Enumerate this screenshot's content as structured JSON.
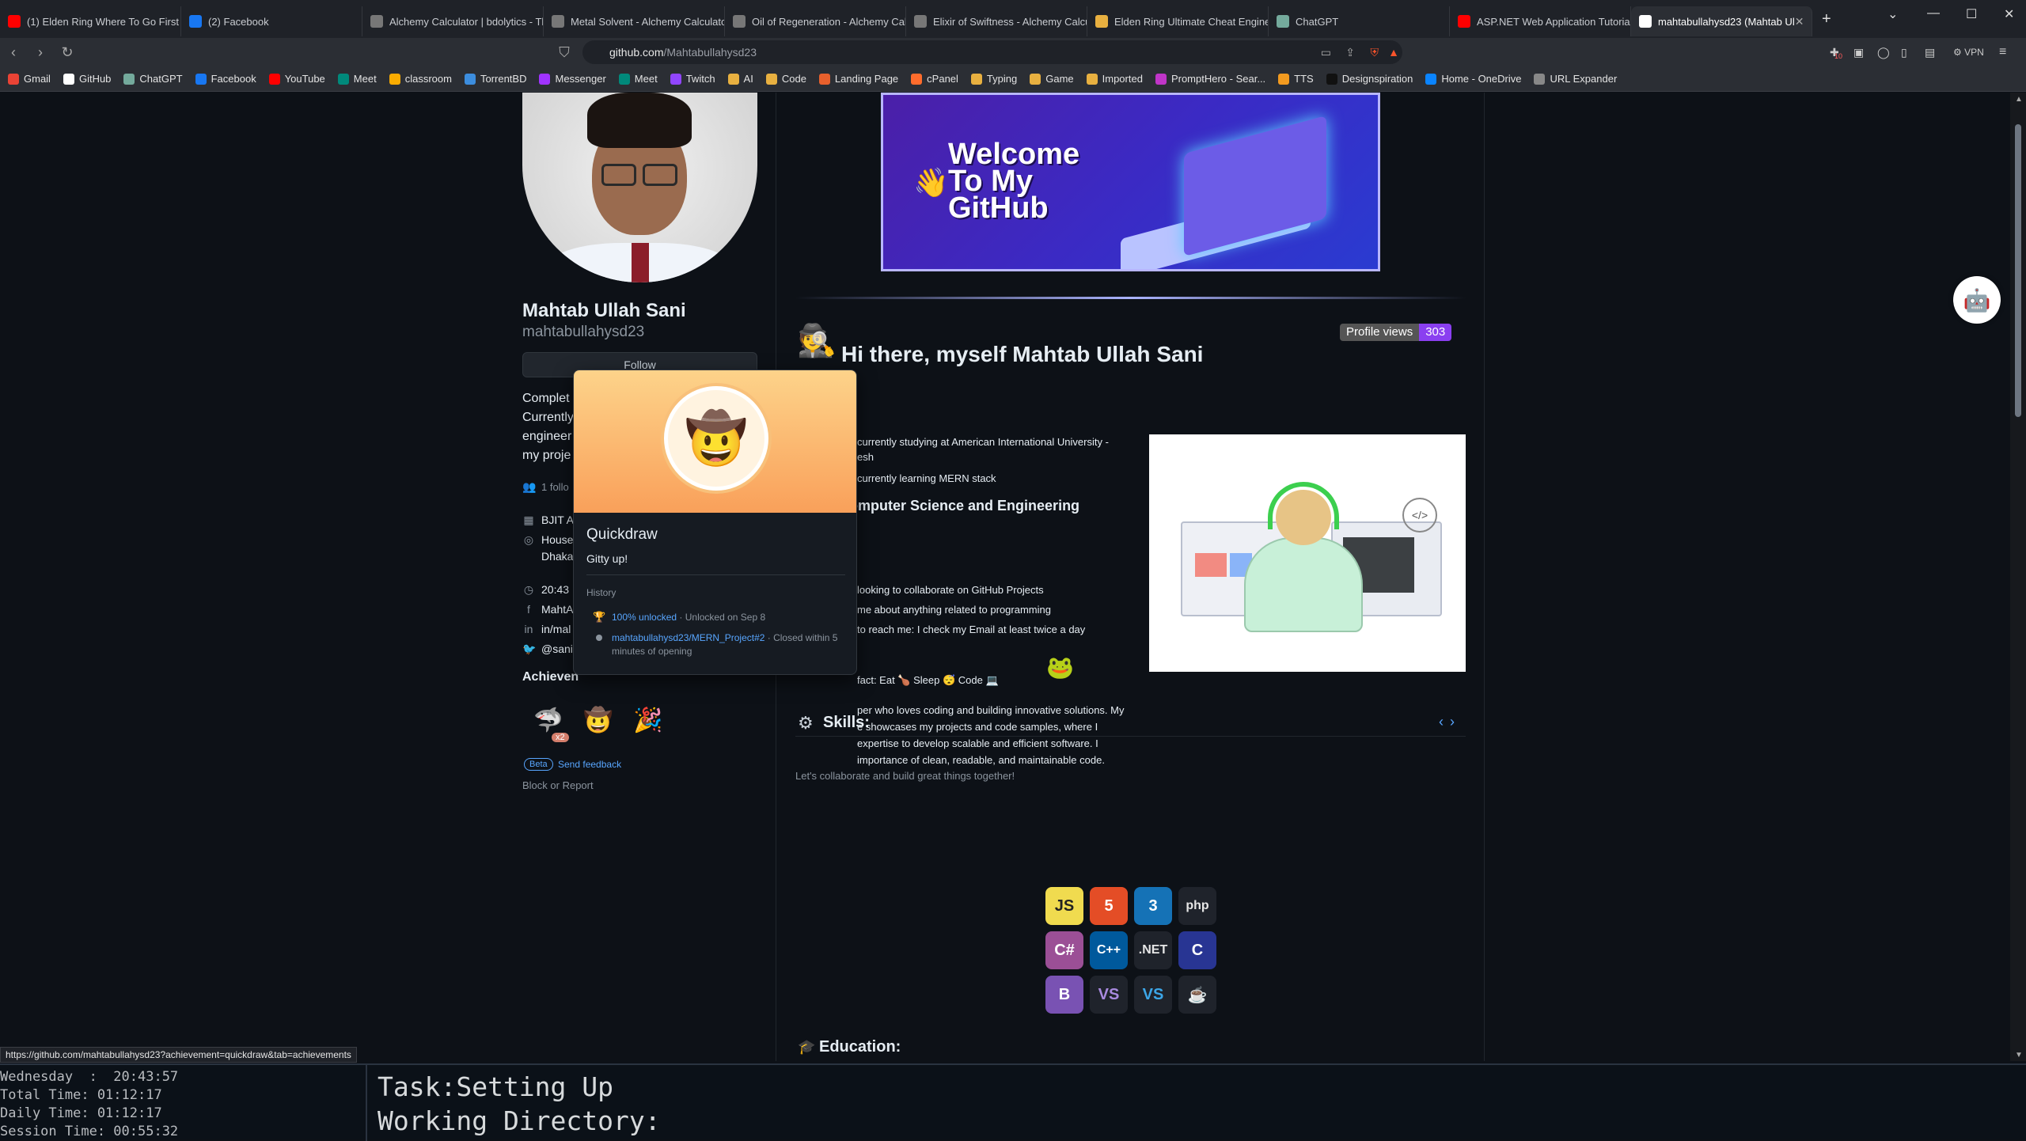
{
  "browser": {
    "tabs": [
      {
        "title": "(1) Elden Ring Where To Go First |",
        "color": "#ff0000",
        "icon": "youtube-icon"
      },
      {
        "title": "(2) Facebook",
        "color": "#1877f2",
        "icon": "facebook-icon"
      },
      {
        "title": "Alchemy Calculator | bdolytics - Th",
        "color": "#777777",
        "icon": "bdolytics-icon"
      },
      {
        "title": "Metal Solvent - Alchemy Calculato",
        "color": "#777777",
        "icon": "bdolytics-icon"
      },
      {
        "title": "Oil of Regeneration - Alchemy Cal",
        "color": "#777777",
        "icon": "bdolytics-icon"
      },
      {
        "title": "Elixir of Swiftness - Alchemy Calcul",
        "color": "#777777",
        "icon": "bdolytics-icon"
      },
      {
        "title": "Elden Ring Ultimate Cheat Engine",
        "color": "#e8b040",
        "icon": "cheat-engine-icon"
      },
      {
        "title": "ChatGPT",
        "color": "#74aa9c",
        "icon": "chatgpt-icon"
      },
      {
        "title": "ASP.NET Web Application Tutorial",
        "color": "#ff0000",
        "icon": "youtube-icon"
      },
      {
        "title": "mahtabullahysd23 (Mahtab Ul",
        "color": "#ffffff",
        "icon": "github-icon",
        "active": true
      }
    ],
    "new_tab": "+",
    "url": {
      "host": "github.com",
      "path": "/Mahtabullahysd23"
    },
    "vpn_label": "VPN",
    "notification_count": "10",
    "bookmarks": [
      {
        "label": "Gmail",
        "color": "#ea4335"
      },
      {
        "label": "GitHub",
        "color": "#ffffff"
      },
      {
        "label": "ChatGPT",
        "color": "#74aa9c"
      },
      {
        "label": "Facebook",
        "color": "#1877f2"
      },
      {
        "label": "YouTube",
        "color": "#ff0000"
      },
      {
        "label": "Meet",
        "color": "#00897b"
      },
      {
        "label": "classroom",
        "color": "#f9ab00"
      },
      {
        "label": "TorrentBD",
        "color": "#3c8dde"
      },
      {
        "label": "Messenger",
        "color": "#a033ff"
      },
      {
        "label": "Meet",
        "color": "#00897b"
      },
      {
        "label": "Twitch",
        "color": "#9146ff"
      },
      {
        "label": "AI",
        "color": "#e8b040"
      },
      {
        "label": "Code",
        "color": "#e8b040"
      },
      {
        "label": "Landing Page",
        "color": "#e8602c"
      },
      {
        "label": "cPanel",
        "color": "#ff6c2c"
      },
      {
        "label": "Typing",
        "color": "#e8b040"
      },
      {
        "label": "Game",
        "color": "#e8b040"
      },
      {
        "label": "Imported",
        "color": "#e8b040"
      },
      {
        "label": "PromptHero - Sear...",
        "color": "#c035c8"
      },
      {
        "label": "TTS",
        "color": "#f29a1f"
      },
      {
        "label": "Designspiration",
        "color": "#111111"
      },
      {
        "label": "Home - OneDrive",
        "color": "#0a84ff"
      },
      {
        "label": "URL Expander",
        "color": "#888888"
      }
    ],
    "status_url": "https://github.com/mahtabullahysd23?achievement=quickdraw&tab=achievements"
  },
  "profile": {
    "name": "Mahtab Ullah Sani",
    "login": "mahtabullahysd23",
    "follow_label": "Follow",
    "bio_lines": [
      "Complet",
      "Currently",
      "engineer",
      "my proje"
    ],
    "followers": "1 follo",
    "meta": [
      {
        "icon": "organization-icon",
        "text": "BJIT A"
      },
      {
        "icon": "location-icon",
        "text": "House"
      },
      {
        "icon": "location-cont",
        "text": "Dhaka"
      },
      {
        "icon": "clock-icon",
        "text": "20:43"
      },
      {
        "icon": "facebook-icon",
        "text": "MahtA"
      },
      {
        "icon": "linkedin-icon",
        "text": "in/mal"
      },
      {
        "icon": "twitter-icon",
        "text": "@sani"
      }
    ],
    "achievements_label": "Achieven",
    "achievement_badges": [
      {
        "name": "pull-shark",
        "emoji": "🦈",
        "count": "x2",
        "color": "#2f5fb0"
      },
      {
        "name": "quickdraw",
        "emoji": "🤠",
        "color": "#f6b86a"
      },
      {
        "name": "yolo",
        "emoji": "🎉",
        "color": "#f7a1c4"
      }
    ],
    "beta_label": "Beta",
    "feedback_label": "Send feedback",
    "block_label": "Block or Report"
  },
  "popup": {
    "title": "Quickdraw",
    "subtitle": "Gitty up!",
    "history_label": "History",
    "history": [
      {
        "link": "100% unlocked",
        "rest": " · Unlocked on Sep 8"
      },
      {
        "link": "mahtabullahysd23/MERN_Project#2",
        "rest": " · Closed within 5 minutes of opening"
      }
    ]
  },
  "readme": {
    "banner_lines": [
      "Welcome",
      "To My",
      "GitHub"
    ],
    "profile_views_label": "Profile views",
    "profile_views_count": "303",
    "greeting": "Hi there, myself Mahtab Ullah Sani",
    "study_heading": "dying Computer Science and Engineering",
    "list": [
      "currently studying at American International University -",
      "esh",
      "currently learning MERN stack",
      "looking to collaborate on GitHub Projects",
      "me about anything related to programming",
      "to reach me: I check my Email at least twice a day"
    ],
    "fun_fact": "fact: Eat 🍗 Sleep 😴 Code 💻",
    "para_lines": [
      "per who loves coding and building innovative solutions. My",
      "e showcases my projects and code samples, where I",
      "expertise to develop scalable and efficient software. I",
      "importance of clean, readable, and maintainable code.",
      "Let's collaborate and build great things together!"
    ],
    "skills_label": "Skills:",
    "skills": [
      {
        "label": "JS",
        "bg": "#f0db4f",
        "fg": "#222222"
      },
      {
        "label": "5",
        "bg": "#e44d26",
        "fg": "#ffffff"
      },
      {
        "label": "3",
        "bg": "#1572b6",
        "fg": "#ffffff"
      },
      {
        "label": "php",
        "bg": "#1f232b",
        "fg": "#e6e6e6"
      },
      {
        "label": "C#",
        "bg": "#9b4f96",
        "fg": "#ffffff"
      },
      {
        "label": "C++",
        "bg": "#00599c",
        "fg": "#ffffff"
      },
      {
        "label": ".NET",
        "bg": "#1f232b",
        "fg": "#e6e6e6"
      },
      {
        "label": "C",
        "bg": "#283593",
        "fg": "#ffffff"
      },
      {
        "label": "B",
        "bg": "#7952b3",
        "fg": "#ffffff"
      },
      {
        "label": "VS",
        "bg": "#1f232b",
        "fg": "#a98adf"
      },
      {
        "label": "VS",
        "bg": "#1f232b",
        "fg": "#3ca6e8"
      },
      {
        "label": "☕",
        "bg": "#1f232b",
        "fg": "#e6e6e6"
      }
    ],
    "education_label": "Education:"
  },
  "terminal": {
    "left_lines": [
      "Wednesday  :  20:43:57",
      "Total Time: 01:12:17",
      "Daily Time: 01:12:17",
      "Session Time: 00:55:32"
    ],
    "right_lines": [
      "Task:Setting Up",
      "Working Directory:"
    ]
  }
}
